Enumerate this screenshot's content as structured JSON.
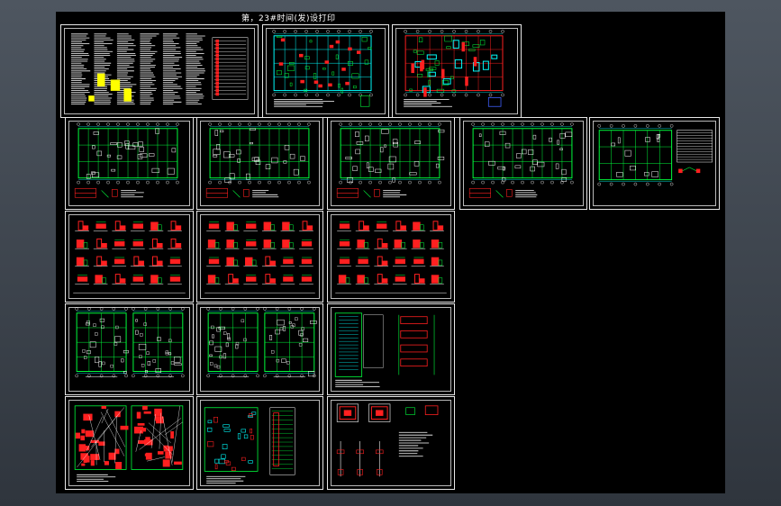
{
  "drawing": {
    "title": "第，23#时间(发)设打印",
    "colors": {
      "background": "#000000",
      "frame": "#e8e8e8",
      "wall": "#00ff3c",
      "dim": "#00ffff",
      "rebar": "#ff2020",
      "note": "#ffffff",
      "highlight": "#ffff00",
      "accent": "#4060ff"
    }
  },
  "sheets": [
    {
      "id": "notes",
      "kind": "notes"
    },
    {
      "id": "plan-a",
      "kind": "plan-detail"
    },
    {
      "id": "plan-b",
      "kind": "plan-red"
    },
    {
      "id": "floor-1",
      "kind": "floor"
    },
    {
      "id": "floor-2",
      "kind": "floor"
    },
    {
      "id": "floor-3",
      "kind": "floor"
    },
    {
      "id": "floor-4",
      "kind": "floor"
    },
    {
      "id": "roof",
      "kind": "roof"
    },
    {
      "id": "detail-1",
      "kind": "details"
    },
    {
      "id": "detail-2",
      "kind": "details"
    },
    {
      "id": "detail-3",
      "kind": "details"
    },
    {
      "id": "twin-1",
      "kind": "twin"
    },
    {
      "id": "twin-2",
      "kind": "twin"
    },
    {
      "id": "stair",
      "kind": "stair"
    },
    {
      "id": "slab-red",
      "kind": "slab-red"
    },
    {
      "id": "slab-mix",
      "kind": "slab-mix"
    },
    {
      "id": "sections",
      "kind": "sections"
    }
  ]
}
